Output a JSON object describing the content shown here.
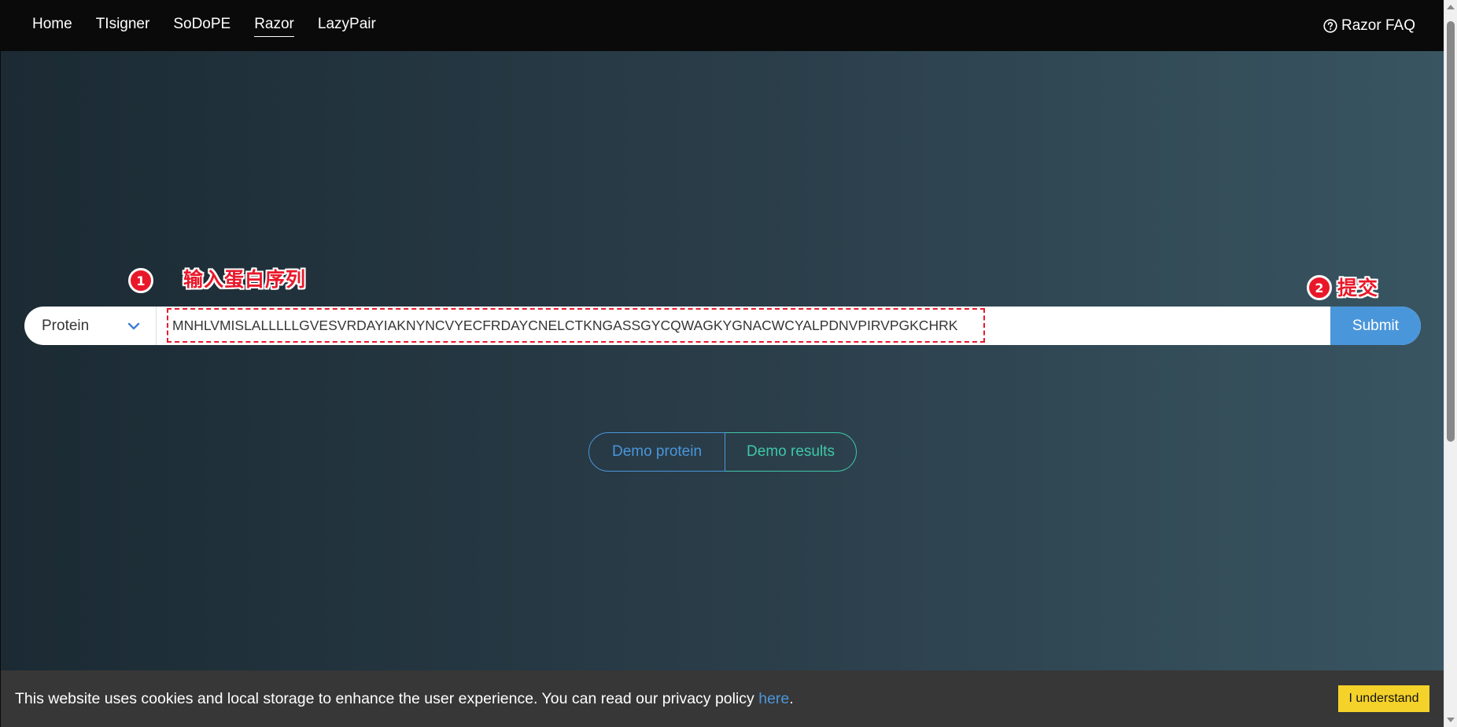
{
  "nav": {
    "items": [
      {
        "label": "Home",
        "active": false
      },
      {
        "label": "TIsigner",
        "active": false
      },
      {
        "label": "SoDoPE",
        "active": false
      },
      {
        "label": "Razor",
        "active": true
      },
      {
        "label": "LazyPair",
        "active": false
      }
    ],
    "faq_label": "Razor FAQ",
    "faq_icon": "question-circle-icon"
  },
  "search": {
    "type_value": "Protein",
    "sequence": "MNHLVMISLALLLLLGVESVRDAYIAKNYNCVYECFRDAYCNELCTKNGASSGYCQWAGKYGNACWCYALPDNVPIRVPGKCHRK",
    "submit_label": "Submit"
  },
  "annotations": {
    "step1_number": "1",
    "step1_text": "输入蛋白序列",
    "step2_number": "2",
    "step2_text": "提交",
    "color": "#e8182a"
  },
  "demo": {
    "protein_label": "Demo protein",
    "results_label": "Demo results"
  },
  "cookie": {
    "text_before": "This website uses cookies and local storage to enhance the user experience. You can read our privacy policy ",
    "link_label": "here",
    "text_after": ".",
    "button_label": "I understand"
  },
  "colors": {
    "accent": "#4a96db",
    "teal": "#3fc7a8",
    "cookie_button": "#f5d22a"
  }
}
